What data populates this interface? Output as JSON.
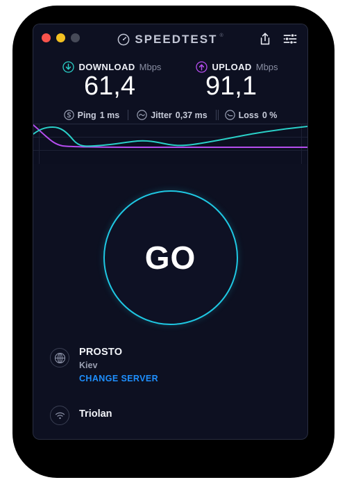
{
  "window": {
    "traffic_lights": [
      {
        "name": "close",
        "color": "#f9534c"
      },
      {
        "name": "minimize",
        "color": "#f2c021"
      },
      {
        "name": "maximize",
        "color": "#464a58"
      }
    ]
  },
  "header": {
    "brand": "SPEEDTEST",
    "trademark": "®",
    "logo_icon": "gauge-icon",
    "share_label": "Share",
    "share_icon": "share-icon",
    "settings_label": "Settings",
    "settings_icon": "sliders-icon"
  },
  "results": {
    "download": {
      "icon": "download-arrow-icon",
      "label": "DOWNLOAD",
      "unit": "Mbps",
      "value": "61,4",
      "color": "#2ad0c8"
    },
    "upload": {
      "icon": "upload-arrow-icon",
      "label": "UPLOAD",
      "unit": "Mbps",
      "value": "91,1",
      "color": "#b64df0"
    },
    "stats": [
      {
        "icon": "ping-icon",
        "label": "Ping",
        "value": "1 ms"
      },
      {
        "icon": "jitter-icon",
        "label": "Jitter",
        "value": "0,37 ms"
      },
      {
        "icon": "loss-icon",
        "label": "Loss",
        "value": "0 %"
      }
    ]
  },
  "chart_data": {
    "type": "line",
    "title": "",
    "xlabel": "",
    "ylabel": "",
    "grid": true,
    "legend": "none",
    "x": [
      0,
      5,
      10,
      15,
      20,
      25,
      30,
      35,
      40,
      45,
      50,
      55,
      60,
      65,
      70,
      75,
      80,
      85,
      90,
      95,
      100
    ],
    "series": [
      {
        "name": "Download",
        "color": "#2ad0c8",
        "values": [
          52,
          68,
          74,
          74,
          66,
          46,
          34,
          33,
          35,
          38,
          41,
          40,
          35,
          32,
          33,
          37,
          42,
          48,
          54,
          57,
          62
        ]
      },
      {
        "name": "Upload",
        "color": "#b64df0",
        "values": [
          74,
          60,
          44,
          34,
          30,
          29,
          29,
          29,
          29,
          29,
          29,
          29,
          29,
          29,
          29,
          29,
          29,
          29,
          29,
          29,
          29
        ]
      }
    ],
    "ylim": [
      0,
      100
    ],
    "xlim": [
      0,
      100
    ]
  },
  "go": {
    "label": "GO"
  },
  "server": {
    "icon": "globe-icon",
    "sponsor": "PROSTO",
    "location": "Kiev",
    "change_link": "CHANGE SERVER",
    "change_link_color": "#1e8fff"
  },
  "isp": {
    "icon": "wifi-icon",
    "name": "Triolan"
  }
}
